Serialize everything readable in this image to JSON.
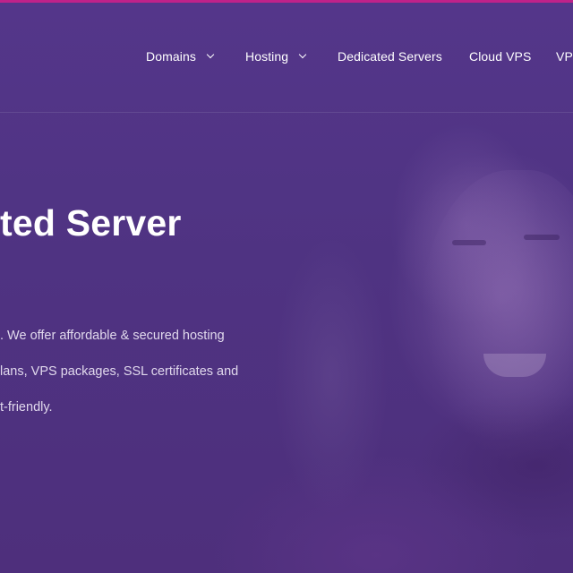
{
  "nav": {
    "items": [
      {
        "label": "Domains",
        "has_dropdown": true
      },
      {
        "label": "Hosting",
        "has_dropdown": true
      },
      {
        "label": "Dedicated Servers",
        "has_dropdown": false
      },
      {
        "label": "Cloud VPS",
        "has_dropdown": false
      },
      {
        "label": "VP",
        "has_dropdown": false
      }
    ]
  },
  "hero": {
    "headline": "ted Server",
    "description_lines": [
      ". We offer affordable & secured hosting",
      "lans, VPS packages, SSL certificates and",
      "t-friendly."
    ]
  },
  "colors": {
    "background": "#4f3482",
    "top_accent": "#c0228a",
    "text": "#ffffff",
    "body_text": "#e0d8ec"
  }
}
